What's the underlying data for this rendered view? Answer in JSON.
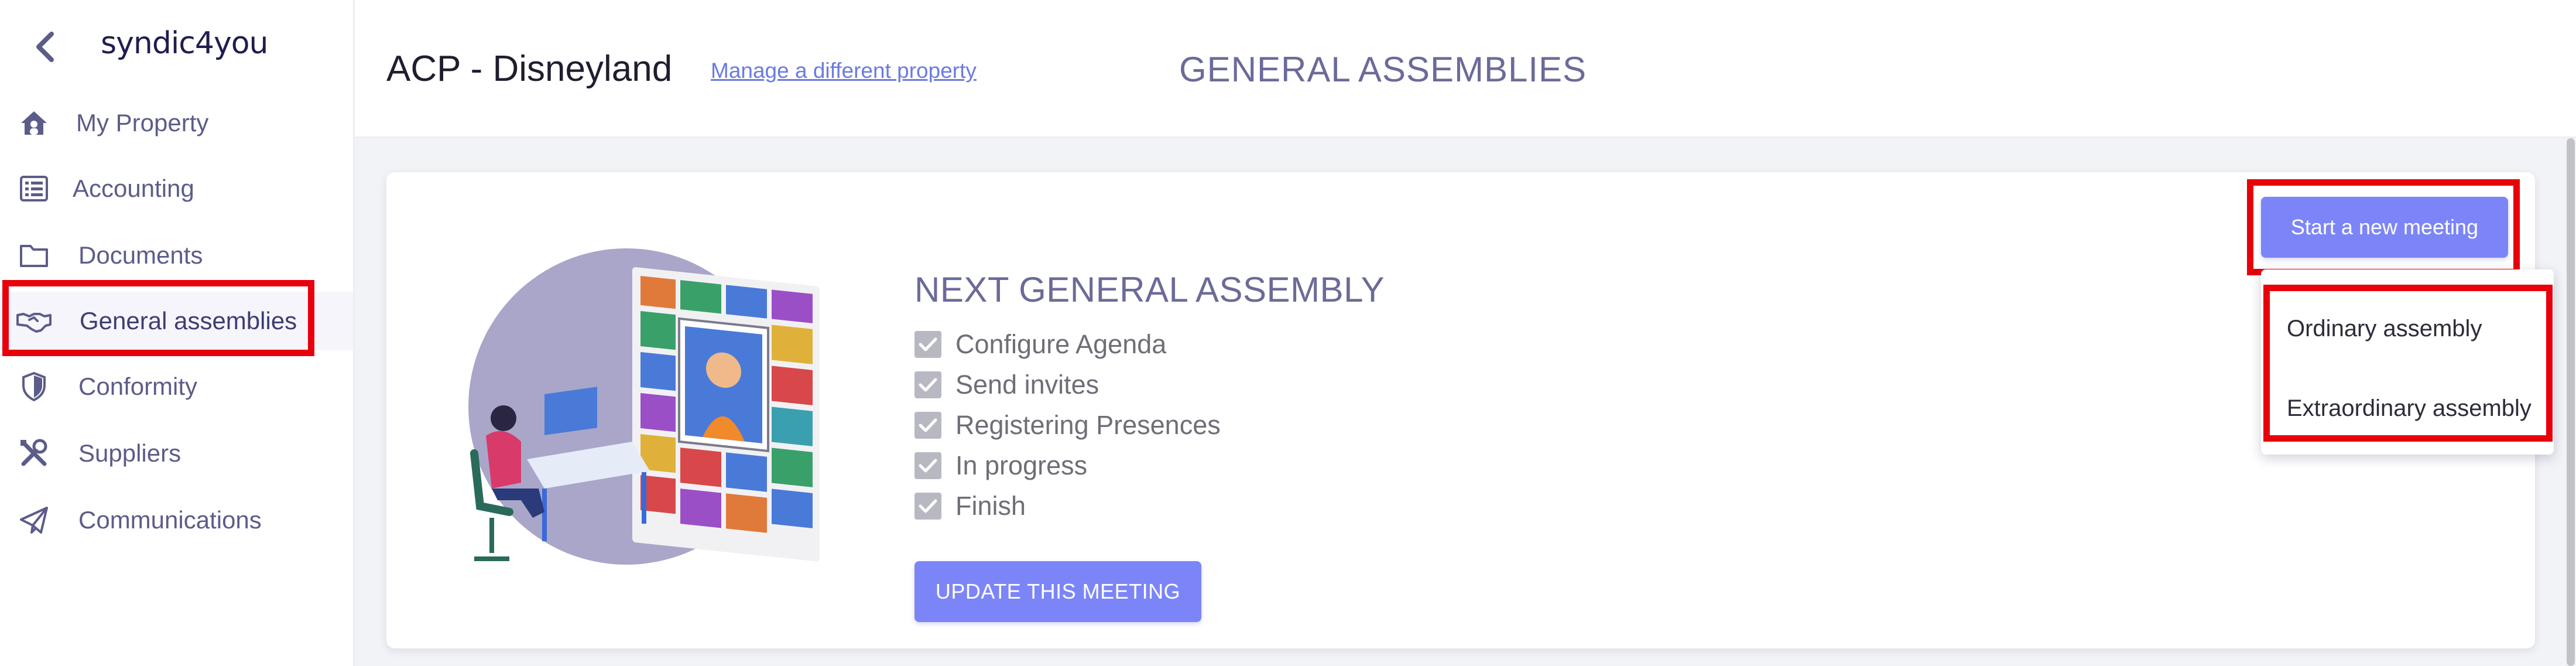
{
  "app": {
    "logo_text": "syndic4you"
  },
  "sidebar": {
    "items": [
      {
        "label": "My Property",
        "icon": "house-icon"
      },
      {
        "label": "Accounting",
        "icon": "list-icon"
      },
      {
        "label": "Documents",
        "icon": "folder-icon"
      },
      {
        "label": "General assemblies",
        "icon": "handshake-icon",
        "active": true
      },
      {
        "label": "Conformity",
        "icon": "shield-icon"
      },
      {
        "label": "Suppliers",
        "icon": "tools-icon"
      },
      {
        "label": "Communications",
        "icon": "paper-plane-icon"
      }
    ]
  },
  "header": {
    "property_title": "ACP - Disneyland",
    "manage_link": "Manage a different property",
    "page_title": "GENERAL ASSEMBLIES"
  },
  "card": {
    "title": "NEXT GENERAL ASSEMBLY",
    "steps": [
      {
        "label": "Configure Agenda",
        "checked": true
      },
      {
        "label": "Send invites",
        "checked": true
      },
      {
        "label": "Registering Presences",
        "checked": true
      },
      {
        "label": "In progress",
        "checked": true
      },
      {
        "label": "Finish",
        "checked": true
      }
    ],
    "update_button": "UPDATE THIS MEETING",
    "start_button": "Start a new meeting",
    "dropdown_options": [
      "Ordinary assembly",
      "Extraordinary assembly"
    ]
  },
  "colors": {
    "accent": "#7c85f7",
    "highlight": "#e8000b",
    "sidebar_text": "#5c5c8a",
    "title_text": "#6b6b99"
  }
}
